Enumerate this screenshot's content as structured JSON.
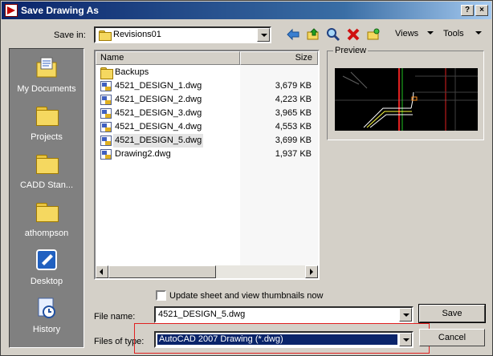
{
  "window": {
    "title": "Save Drawing As"
  },
  "toolbar": {
    "save_in_label": "Save in:",
    "save_in_value": "Revisions01",
    "views_label": "Views",
    "tools_label": "Tools"
  },
  "places": [
    {
      "label": "My Documents",
      "icon": "my-documents-icon"
    },
    {
      "label": "Projects",
      "icon": "folder-icon"
    },
    {
      "label": "CADD Stan...",
      "icon": "folder-icon"
    },
    {
      "label": "athompson",
      "icon": "folder-icon"
    },
    {
      "label": "Desktop",
      "icon": "desktop-icon"
    },
    {
      "label": "History",
      "icon": "history-icon"
    }
  ],
  "filelist": {
    "columns": [
      "Name",
      "Size"
    ],
    "rows": [
      {
        "name": "Backups",
        "size": "",
        "type": "folder"
      },
      {
        "name": "4521_DESIGN_1.dwg",
        "size": "3,679 KB",
        "type": "dwg"
      },
      {
        "name": "4521_DESIGN_2.dwg",
        "size": "4,223 KB",
        "type": "dwg"
      },
      {
        "name": "4521_DESIGN_3.dwg",
        "size": "3,965 KB",
        "type": "dwg"
      },
      {
        "name": "4521_DESIGN_4.dwg",
        "size": "4,553 KB",
        "type": "dwg"
      },
      {
        "name": "4521_DESIGN_5.dwg",
        "size": "3,699 KB",
        "type": "dwg",
        "selected": true
      },
      {
        "name": "Drawing2.dwg",
        "size": "1,937 KB",
        "type": "dwg"
      }
    ]
  },
  "preview": {
    "label": "Preview"
  },
  "options": {
    "thumbnail_label": "Update sheet and view thumbnails now",
    "thumbnail_checked": false
  },
  "filename": {
    "label": "File name:",
    "value": "4521_DESIGN_5.dwg"
  },
  "filetype": {
    "label": "Files of type:",
    "value": "AutoCAD 2007 Drawing (*.dwg)"
  },
  "buttons": {
    "save": "Save",
    "cancel": "Cancel"
  },
  "titlebar_buttons": {
    "help": "?",
    "close": "×"
  },
  "colors": {
    "titlebar": "#0a246a",
    "dialog_bg": "#d4d0c8",
    "highlight": "#e02020",
    "selection": "#0a246a"
  }
}
